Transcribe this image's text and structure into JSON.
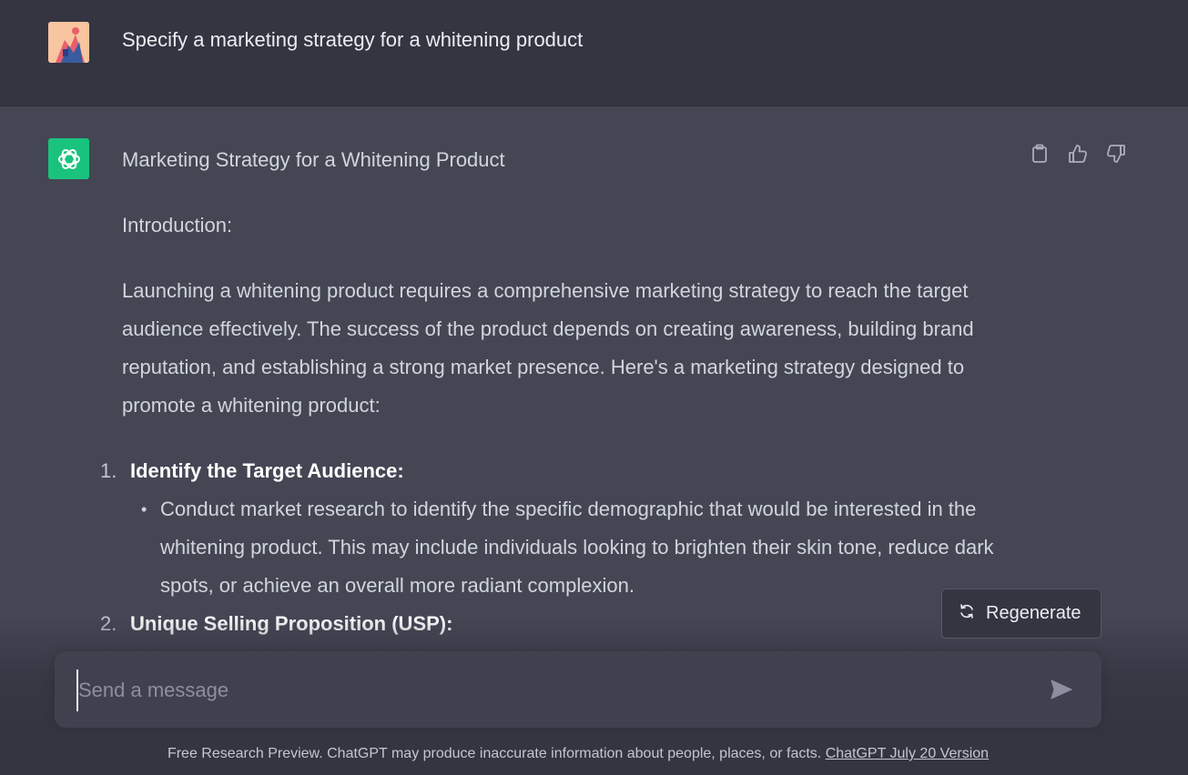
{
  "user_message": {
    "text": "Specify a marketing strategy for a whitening product"
  },
  "assistant_message": {
    "title": "Marketing Strategy for a Whitening Product",
    "intro_label": "Introduction:",
    "intro_paragraph": "Launching a whitening product requires a comprehensive marketing strategy to reach the target audience effectively. The success of the product depends on creating awareness, building brand reputation, and establishing a strong market presence. Here's a marketing strategy designed to promote a whitening product:",
    "list": [
      {
        "number": "1.",
        "heading": "Identify the Target Audience:",
        "bullets": [
          "Conduct market research to identify the specific demographic that would be interested in the whitening product. This may include individuals looking to brighten their skin tone, reduce dark spots, or achieve an overall more radiant complexion."
        ]
      },
      {
        "number": "2.",
        "heading": "Unique Selling Proposition (USP):",
        "bullets": []
      }
    ]
  },
  "actions": {
    "copy_icon": "clipboard-icon",
    "like_icon": "thumbs-up-icon",
    "dislike_icon": "thumbs-down-icon"
  },
  "regenerate": {
    "label": "Regenerate"
  },
  "composer": {
    "placeholder": "Send a message",
    "value": ""
  },
  "footer": {
    "text": "Free Research Preview. ChatGPT may produce inaccurate information about people, places, or facts.",
    "link": "ChatGPT July 20 Version"
  },
  "colors": {
    "bg_user": "#343541",
    "bg_assistant": "#444654",
    "bot_avatar": "#19c37d",
    "input_bg": "#40414f"
  }
}
